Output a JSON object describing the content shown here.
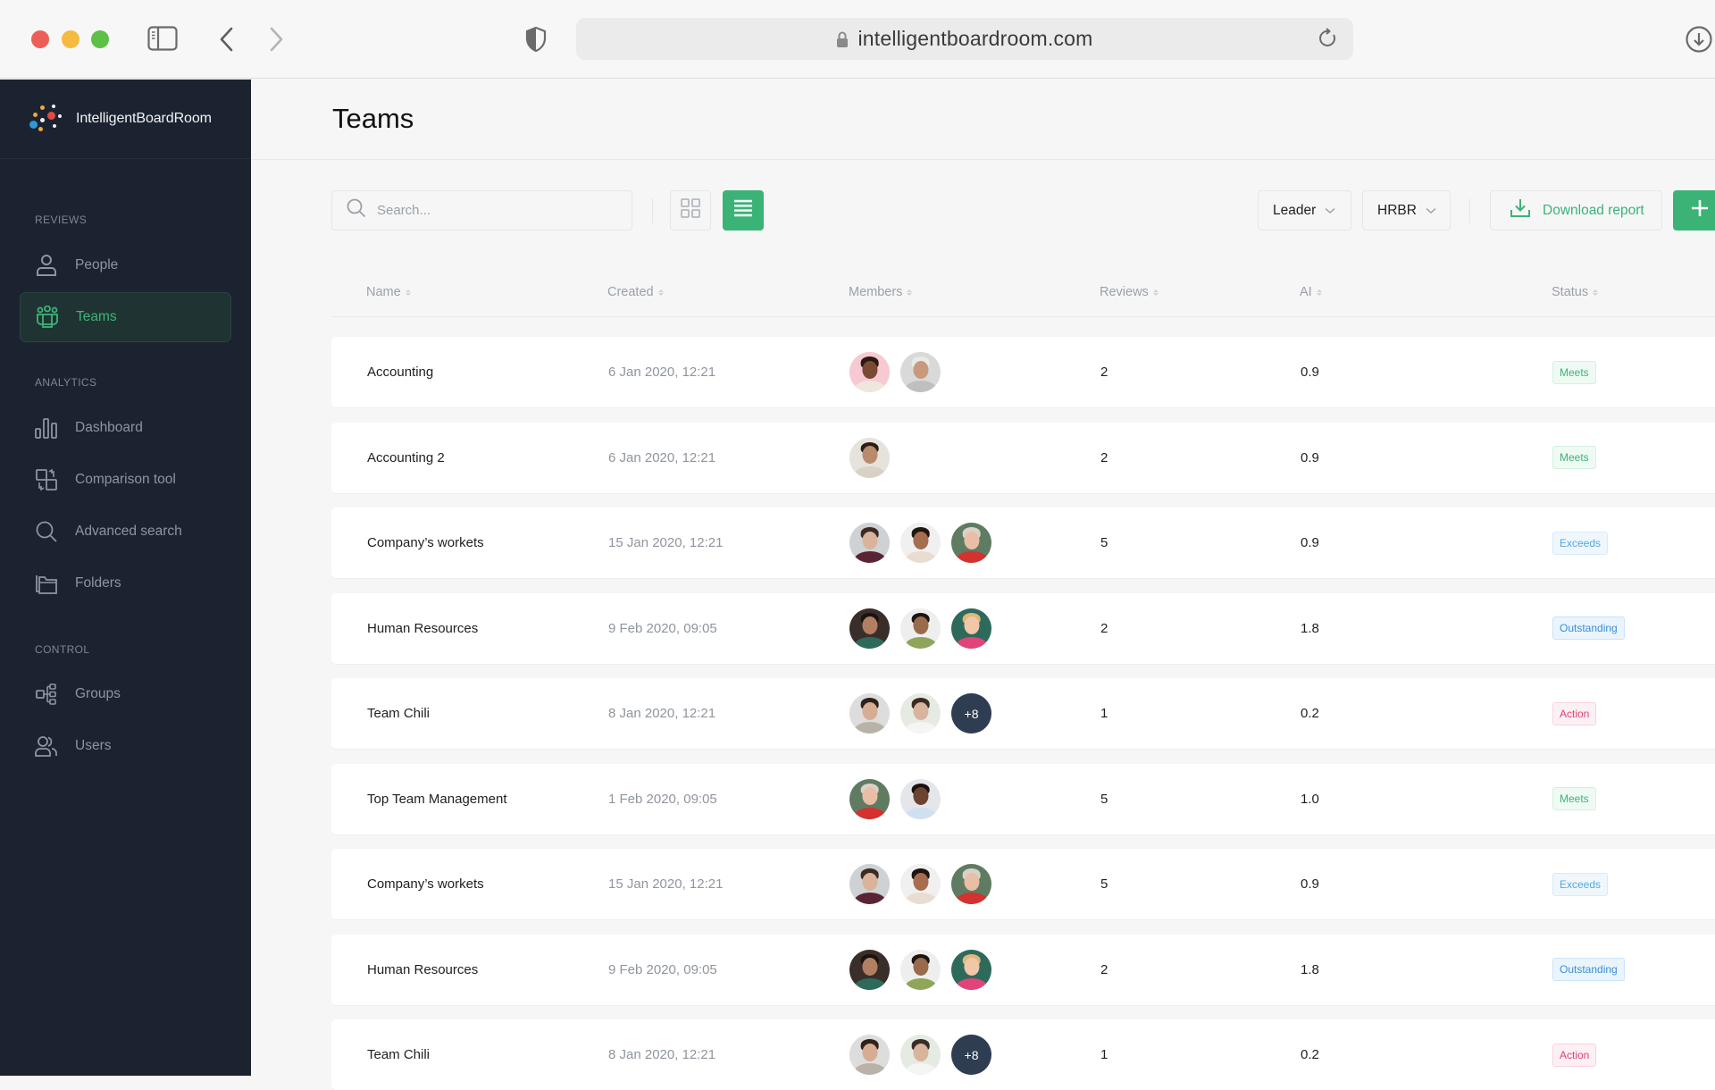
{
  "browser": {
    "url": "intelligentboardroom.com"
  },
  "sidebar": {
    "brand": "IntelligentBoardRoom",
    "sections": [
      {
        "label": "REVIEWS",
        "items": [
          {
            "label": "People",
            "icon": "person-icon",
            "active": false
          },
          {
            "label": "Teams",
            "icon": "teams-icon",
            "active": true
          }
        ]
      },
      {
        "label": "ANALYTICS",
        "items": [
          {
            "label": "Dashboard",
            "icon": "bar-chart-icon",
            "active": false
          },
          {
            "label": "Comparison tool",
            "icon": "compare-icon",
            "active": false
          },
          {
            "label": "Advanced search",
            "icon": "search-icon",
            "active": false
          },
          {
            "label": "Folders",
            "icon": "folder-icon",
            "active": false
          }
        ]
      },
      {
        "label": "CONTROL",
        "items": [
          {
            "label": "Groups",
            "icon": "hierarchy-icon",
            "active": false
          },
          {
            "label": "Users",
            "icon": "users-icon",
            "active": false
          }
        ]
      }
    ]
  },
  "page": {
    "title": "Teams"
  },
  "toolbar": {
    "search_placeholder": "Search...",
    "search_value": "",
    "view_mode": "list",
    "filter_leader": "Leader",
    "filter_hrbr": "HRBR",
    "download_label": "Download report",
    "add_label": "+"
  },
  "table": {
    "columns": [
      "Name",
      "Created",
      "Members",
      "Reviews",
      "AI",
      "Status"
    ],
    "rows": [
      {
        "name": "Accounting",
        "created": "6 Jan 2020, 12:21",
        "members": [
          "a1",
          "a2"
        ],
        "extra_members": "",
        "reviews": "2",
        "ai": "0.9",
        "status": "Meets"
      },
      {
        "name": "Accounting 2",
        "created": "6 Jan 2020, 12:21",
        "members": [
          "a3"
        ],
        "extra_members": "",
        "reviews": "2",
        "ai": "0.9",
        "status": "Meets"
      },
      {
        "name": "Company’s workets",
        "created": "15 Jan 2020, 12:21",
        "members": [
          "a4",
          "a5",
          "a6"
        ],
        "extra_members": "",
        "reviews": "5",
        "ai": "0.9",
        "status": "Exceeds"
      },
      {
        "name": "Human Resources",
        "created": "9 Feb 2020, 09:05",
        "members": [
          "a7",
          "a8",
          "a9"
        ],
        "extra_members": "",
        "reviews": "2",
        "ai": "1.8",
        "status": "Outstanding"
      },
      {
        "name": "Team Chili",
        "created": "8 Jan 2020, 12:21",
        "members": [
          "a10",
          "a11"
        ],
        "extra_members": "+8",
        "reviews": "1",
        "ai": "0.2",
        "status": "Action"
      },
      {
        "name": "Top Team Management",
        "created": "1 Feb 2020, 09:05",
        "members": [
          "a6",
          "a12"
        ],
        "extra_members": "",
        "reviews": "5",
        "ai": "1.0",
        "status": "Meets"
      },
      {
        "name": "Company’s workets",
        "created": "15 Jan 2020, 12:21",
        "members": [
          "a4",
          "a5",
          "a6"
        ],
        "extra_members": "",
        "reviews": "5",
        "ai": "0.9",
        "status": "Exceeds"
      },
      {
        "name": "Human Resources",
        "created": "9 Feb 2020, 09:05",
        "members": [
          "a7",
          "a8",
          "a9"
        ],
        "extra_members": "",
        "reviews": "2",
        "ai": "1.8",
        "status": "Outstanding"
      },
      {
        "name": "Team Chili",
        "created": "8 Jan 2020, 12:21",
        "members": [
          "a10",
          "a11"
        ],
        "extra_members": "+8",
        "reviews": "1",
        "ai": "0.2",
        "status": "Action"
      }
    ]
  },
  "colors": {
    "accent": "#3bb377",
    "sidebar_bg": "#1c2330",
    "status_meets": "#3bb377",
    "status_exceeds": "#52a8e0",
    "status_outstanding": "#3a8ed8",
    "status_action": "#e2406f"
  }
}
